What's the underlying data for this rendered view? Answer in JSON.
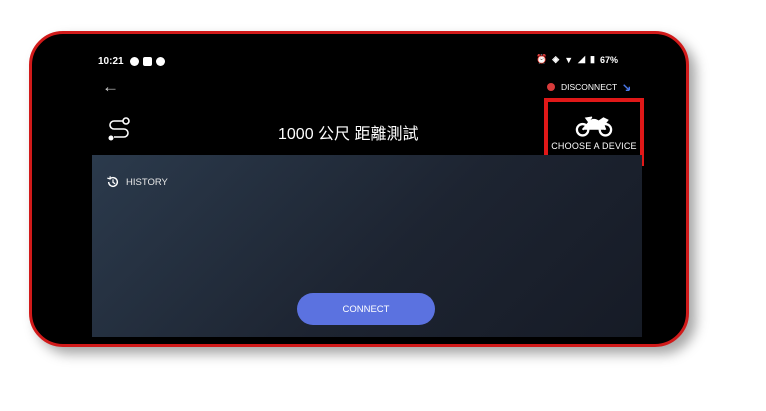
{
  "status_bar": {
    "time": "10:21",
    "battery": "67%"
  },
  "header": {
    "title": "1000 公尺 距離測試",
    "connection_status": "DISCONNECT",
    "choose_device_label": "CHOOSE A DEVICE"
  },
  "panel": {
    "history_label": "HISTORY",
    "connect_button_label": "CONNECT"
  },
  "colors": {
    "connect_button": "#5b72e0",
    "disconnect_dot": "#d83b3b",
    "highlight_border": "#e01818",
    "phone_border": "#d11a1a"
  }
}
